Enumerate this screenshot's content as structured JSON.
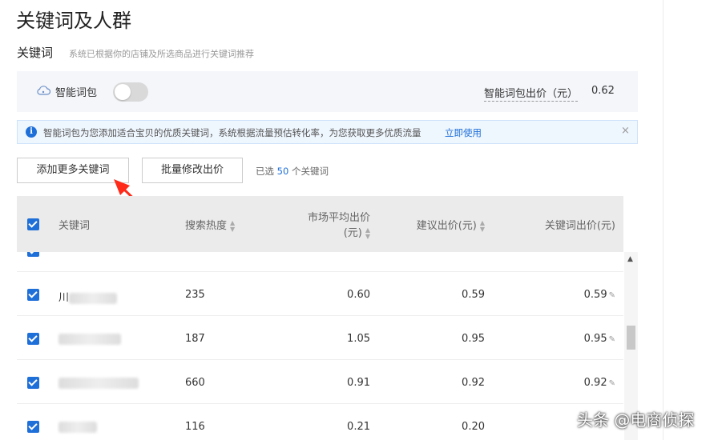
{
  "page_title": "关键词及人群",
  "section": {
    "title": "关键词",
    "subtitle": "系统已根据你的店铺及所选商品进行关键词推荐"
  },
  "smart_pack": {
    "label": "智能词包",
    "toggle_on": false,
    "bid_label": "智能词包出价（元）",
    "bid_value": "0.62"
  },
  "info_bar": {
    "text": "智能词包为您添加适合宝贝的优质关键词，系统根据流量预估转化率，为您获取更多优质流量",
    "link": "立即使用",
    "close": "×"
  },
  "toolbar": {
    "add_label": "添加更多关键词",
    "batch_label": "批量修改出价",
    "selected_prefix": "已选",
    "selected_count": "50",
    "selected_suffix": "个关键词"
  },
  "table": {
    "headers": {
      "keyword": "关键词",
      "heat": "搜索热度",
      "avg_bid_line1": "市场平均出价",
      "avg_bid_line2": "(元)",
      "suggested": "建议出价(元)",
      "my_bid": "关键词出价(元)"
    },
    "rows": [
      {
        "keyword_visible": "",
        "heat": "",
        "avg": "",
        "suggested": "",
        "bid": ""
      },
      {
        "keyword_visible": "川",
        "heat": "235",
        "avg": "0.60",
        "suggested": "0.59",
        "bid": "0.59"
      },
      {
        "keyword_visible": "",
        "heat": "187",
        "avg": "1.05",
        "suggested": "0.95",
        "bid": "0.95"
      },
      {
        "keyword_visible": "",
        "heat": "660",
        "avg": "0.91",
        "suggested": "0.92",
        "bid": "0.92"
      },
      {
        "keyword_visible": "",
        "heat": "116",
        "avg": "0.21",
        "suggested": "0.20",
        "bid": ""
      }
    ]
  },
  "icons": {
    "edit": "edit-icon",
    "cloud": "cloud-icon",
    "info": "info-icon",
    "scroll_up": "▲"
  },
  "colors": {
    "accent": "#1f6fd8",
    "arrow": "#ff2a1a"
  },
  "watermark": "头条 @电商侦探"
}
